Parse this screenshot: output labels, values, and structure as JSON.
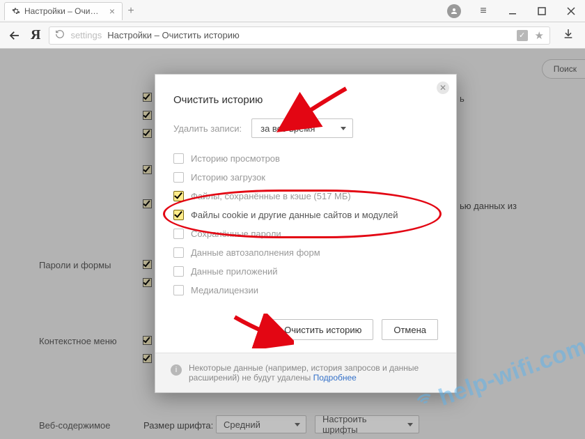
{
  "titlebar": {
    "tab_title": "Настройки – Очистить и…",
    "new_tab_glyph": "+"
  },
  "toolbar": {
    "ya_glyph": "Я",
    "url_path": "settings",
    "url_title": "Настройки – Очистить историю"
  },
  "page_bg": {
    "search_label": "Поиск",
    "scrap_right_1": "ь",
    "scrap_right_2": "ью данных из",
    "section_passwords": "Пароли и формы",
    "section_context": "Контекстное меню",
    "section_web": "Веб-содержимое",
    "font_size_label": "Размер шрифта:",
    "font_size_value": "Средний",
    "fonts_button": "Настроить шрифты"
  },
  "dialog": {
    "title": "Очистить историю",
    "delete_label": "Удалить записи:",
    "range_value": "за всё время",
    "items": [
      {
        "label": "Историю просмотров",
        "checked": false,
        "dark": false
      },
      {
        "label": "Историю загрузок",
        "checked": false,
        "dark": false
      },
      {
        "label": "Файлы, сохранённые в кэше (517 МБ)",
        "checked": true,
        "dark": false
      },
      {
        "label": "Файлы cookie и другие данные сайтов и модулей",
        "checked": true,
        "dark": true
      },
      {
        "label": "Сохранённые пароли",
        "checked": false,
        "dark": false
      },
      {
        "label": "Данные автозаполнения форм",
        "checked": false,
        "dark": false
      },
      {
        "label": "Данные приложений",
        "checked": false,
        "dark": false
      },
      {
        "label": "Медиалицензии",
        "checked": false,
        "dark": false
      }
    ],
    "primary_button": "Очистить историю",
    "cancel_button": "Отмена",
    "footer_text": "Некоторые данные (например, история запросов и данные расширений) не будут удалены ",
    "footer_link": "Подробнее"
  },
  "watermark": "help-wifi.com"
}
